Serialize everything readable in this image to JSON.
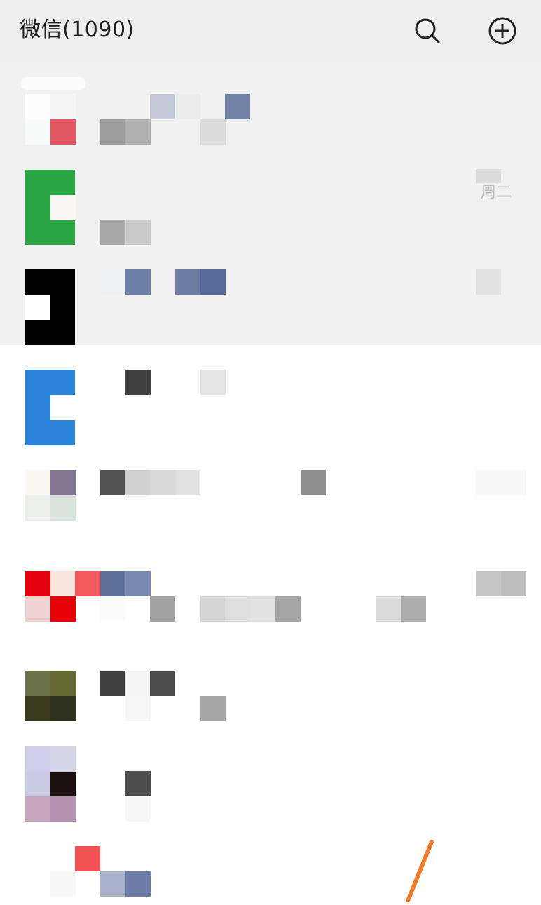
{
  "header": {
    "title": "微信(1090)",
    "search_icon": "search-icon",
    "add_icon": "plus-circle-icon"
  },
  "chat_list": {
    "rows": [
      {
        "avatar": "pixelated-avatar",
        "pinned": true,
        "time": ""
      },
      {
        "avatar": "green-pixelated-avatar",
        "pinned": true,
        "time": "周二"
      },
      {
        "avatar": "black-pixelated-avatar",
        "pinned": true,
        "time": ""
      },
      {
        "avatar": "blue-pixelated-avatar",
        "pinned": false,
        "time": ""
      },
      {
        "avatar": "pixelated-avatar",
        "pinned": false,
        "time": ""
      },
      {
        "avatar": "red-pixelated-avatar",
        "pinned": false,
        "time": ""
      },
      {
        "avatar": "olive-pixelated-avatar",
        "pinned": false,
        "time": ""
      },
      {
        "avatar": "lavender-pixelated-avatar",
        "pinned": false,
        "time": ""
      },
      {
        "avatar": "pixelated-avatar",
        "pinned": false,
        "time": ""
      }
    ]
  },
  "colors": {
    "header_bg": "#ededed",
    "pinned_bg": "#f1f1f1",
    "list_bg": "#ffffff",
    "annotation": "#f07c2a"
  }
}
